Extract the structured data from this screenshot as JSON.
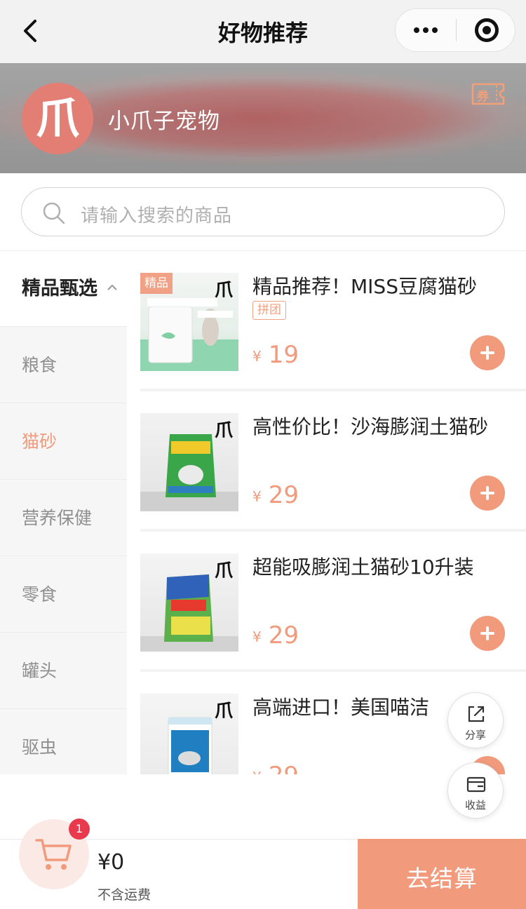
{
  "navbar": {
    "title": "好物推荐"
  },
  "shop": {
    "name": "小爪子宠物",
    "logo_glyph": "爪",
    "coupon_label": "券"
  },
  "search": {
    "placeholder": "请输入搜索的商品"
  },
  "categories": [
    {
      "label": "精品甄选",
      "state": "active"
    },
    {
      "label": "粮食",
      "state": "normal"
    },
    {
      "label": "猫砂",
      "state": "highlight"
    },
    {
      "label": "营养保健",
      "state": "normal"
    },
    {
      "label": "零食",
      "state": "normal"
    },
    {
      "label": "罐头",
      "state": "normal"
    },
    {
      "label": "驱虫",
      "state": "normal"
    }
  ],
  "products": [
    {
      "name": "精品推荐！MISS豆腐猫砂",
      "tag": "拼团",
      "badge": "精品",
      "currency": "¥",
      "price": "19",
      "brand_mark": "爪"
    },
    {
      "name": "高性价比！沙海膨润土猫砂",
      "tag": "",
      "badge": "",
      "currency": "¥",
      "price": "29",
      "brand_mark": "爪"
    },
    {
      "name": "超能吸膨润土猫砂10升装",
      "tag": "",
      "badge": "",
      "currency": "¥",
      "price": "29",
      "brand_mark": "爪"
    },
    {
      "name": "高端进口！美国喵洁",
      "tag": "",
      "badge": "",
      "currency": "¥",
      "price": "29",
      "brand_mark": "爪"
    }
  ],
  "floating": {
    "share_label": "分享",
    "earnings_label": "收益"
  },
  "cart": {
    "count": "1",
    "total": "¥0",
    "shipping_note": "不含运费"
  },
  "checkout": {
    "label": "去结算"
  },
  "colors": {
    "accent": "#f19a7c",
    "badge_red": "#e8394d",
    "logo_bg": "#e37e74"
  },
  "icons": [
    "back-arrow-icon",
    "more-dots-icon",
    "target-circle-icon",
    "coupon-icon",
    "search-icon",
    "chevron-up-icon",
    "plus-icon",
    "share-icon",
    "wallet-icon",
    "cart-icon"
  ]
}
